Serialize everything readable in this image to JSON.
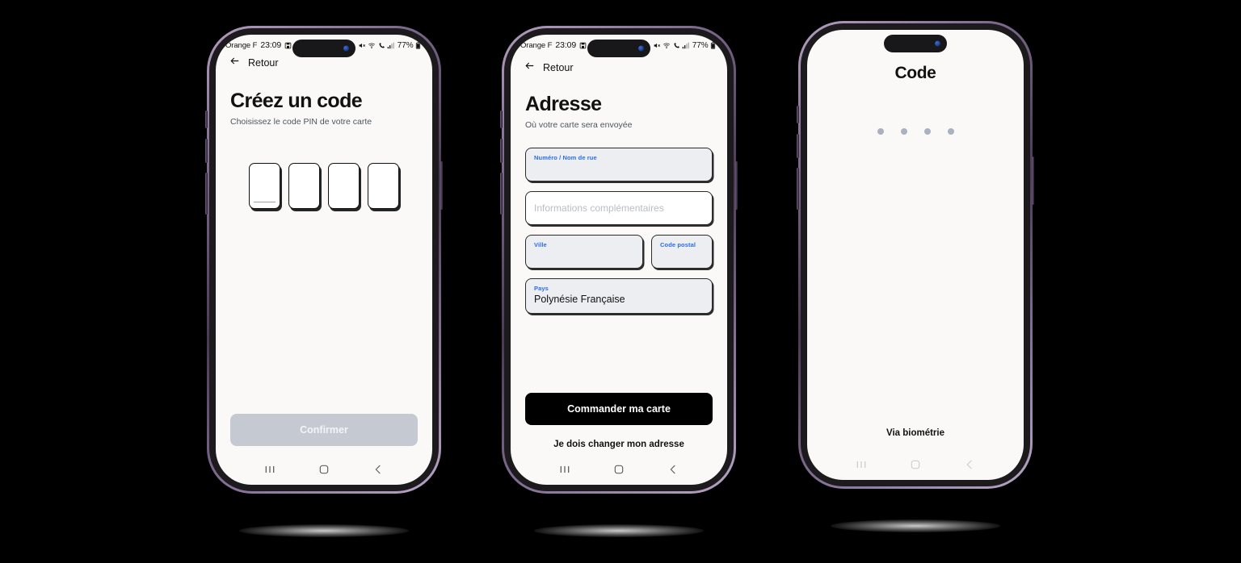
{
  "colors": {
    "screen_bg": "#faf9f7",
    "accent_label": "#2a6cf0",
    "dark_button": "#000000",
    "disabled_button": "#c5cad2",
    "dot": "#aab2bf",
    "frame_rim": "#8a769b",
    "frame_body": "#1c1a1d"
  },
  "status_bar": {
    "carrier": "Orange F",
    "time": "23:09",
    "battery": "77%",
    "icons": [
      "save-icon",
      "alarm-icon",
      "bluetooth-icon",
      "mute-icon",
      "wifi-icon",
      "call-forward-icon",
      "signal-icon",
      "battery-icon"
    ]
  },
  "nav_bar": {
    "recents": "recents-icon",
    "home": "home-icon",
    "back": "back-icon"
  },
  "phones": [
    {
      "id": "phone-create-pin",
      "back_label": "Retour",
      "title": "Créez un code",
      "subtitle": "Choisissez le code PIN de votre carte",
      "pin_boxes": 4,
      "pin_values": [
        "",
        "",
        "",
        ""
      ],
      "primary_button": "Confirmer",
      "primary_button_state": "disabled"
    },
    {
      "id": "phone-address",
      "back_label": "Retour",
      "title": "Adresse",
      "subtitle": "Où votre carte sera envoyée",
      "fields": [
        {
          "label": "Numéro / Nom de rue",
          "value": "",
          "placeholder": ""
        },
        {
          "label": "",
          "value": "",
          "placeholder": "Informations complémentaires"
        },
        {
          "label": "Ville",
          "value": "",
          "placeholder": ""
        },
        {
          "label": "Code postal",
          "value": "",
          "placeholder": ""
        },
        {
          "label": "Pays",
          "value": "Polynésie Française",
          "placeholder": ""
        }
      ],
      "primary_button": "Commander ma carte",
      "secondary_link": "Je dois changer mon adresse"
    },
    {
      "id": "phone-code-lock",
      "title": "Code",
      "dots": 4,
      "biometric_label": "Via biométrie"
    }
  ]
}
